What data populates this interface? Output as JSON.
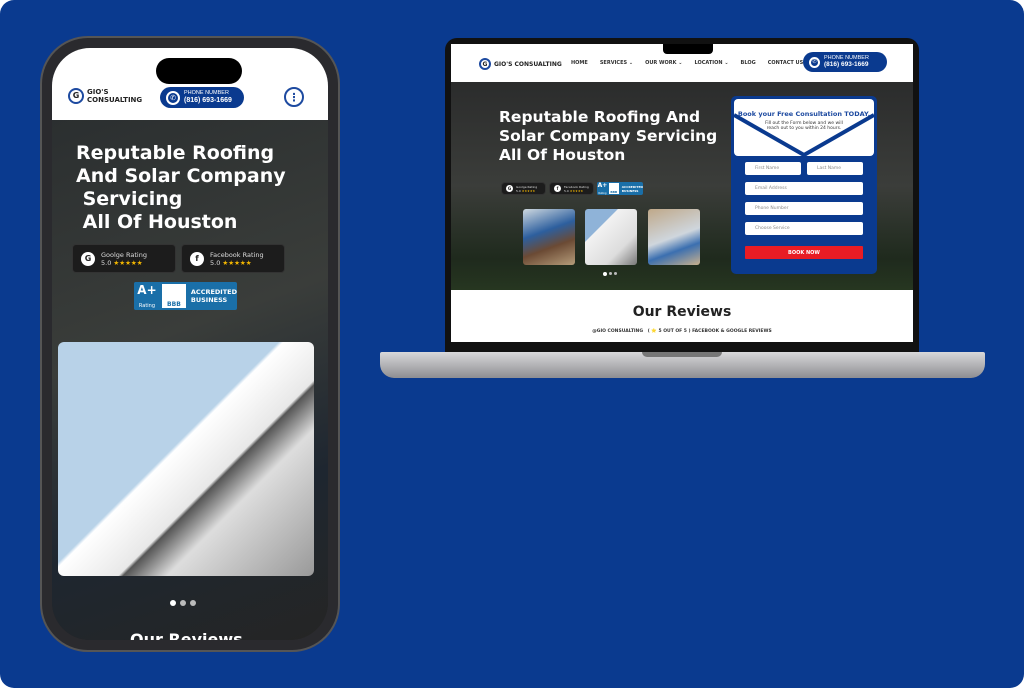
{
  "brand": {
    "name": "GIO'S CONSUALTING",
    "mobile_name_line1": "GIO'S",
    "mobile_name_line2": "CONSUALTING",
    "logo_letter": "G"
  },
  "phone": {
    "label": "PHONE NUMBER",
    "number": "(816) 693-1669"
  },
  "nav": {
    "items": [
      "HOME",
      "SERVICES",
      "OUR WORK",
      "LOCATION",
      "BLOG",
      "CONTACT US"
    ]
  },
  "hero": {
    "title_desktop": "Reputable Roofing And\nSolar Company Servicing\nAll Of Houston",
    "title_mobile": "Reputable Roofing\nAnd Solar Company\n Servicing\n All Of Houston"
  },
  "ratings": [
    {
      "name": "Goolge Rating",
      "score": "5.0",
      "stars": "★★★★★",
      "icon": "G"
    },
    {
      "name": "Facebook Rating",
      "score": "5.0",
      "stars": "★★★★★",
      "icon": "f"
    }
  ],
  "bbb": {
    "grade": "A+",
    "grade_label": "Rating",
    "logo": "BBB",
    "line1": "ACCREDITED",
    "line2": "BUSINESS"
  },
  "form": {
    "title": "Book your Free Consultation TODAY.",
    "subtitle": "Fill out the Form below and we will reach out to you within 24 hours.",
    "first_name": "First Name",
    "last_name": "Last Name",
    "email": "Email Address",
    "phone": "Phone Number",
    "service": "Choose Service",
    "submit": "BOOK NOW"
  },
  "reviews": {
    "title": "Our Reviews",
    "handle": "@GIO CONSUALTING",
    "summary": "( ⭐ 5 OUT OF 5 ) FACEBOOK & GOOGLE REVIEWS"
  },
  "colors": {
    "background": "#0a3a8f",
    "accent": "#1d4aa0",
    "button": "#e81c24",
    "stars": "#f5b800"
  }
}
